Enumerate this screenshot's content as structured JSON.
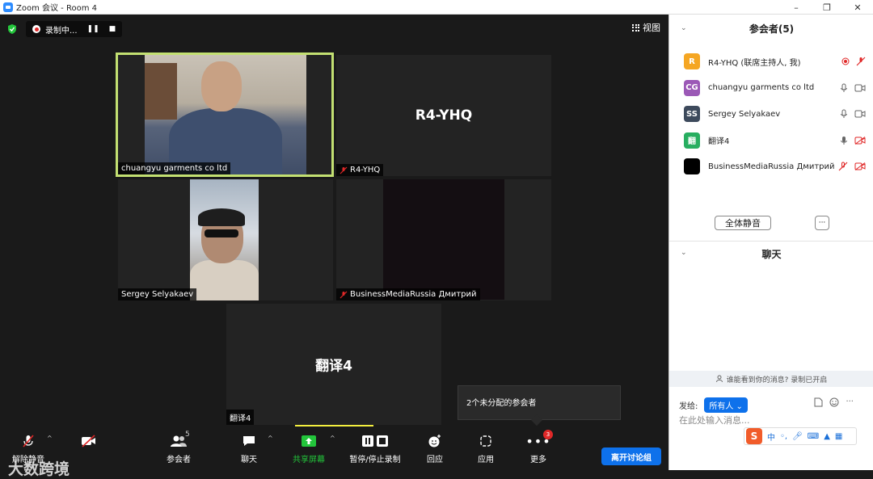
{
  "window": {
    "title": "Zoom 会议 - Room 4",
    "controls": [
      "–",
      "❐",
      "✕"
    ]
  },
  "topbar": {
    "recording_label": "录制中...",
    "view_label": "视图"
  },
  "tiles": [
    {
      "name": "chuangyu garments co ltd",
      "has_video": true,
      "active": true,
      "muted": false
    },
    {
      "name": "R4-YHQ",
      "big_label": "R4-YHQ",
      "has_video": false,
      "muted": true
    },
    {
      "name": "Sergey Selyakaev",
      "has_video": true,
      "muted": false
    },
    {
      "name": "BusinessMediaRussia Дмитрий",
      "has_video": true,
      "muted": true
    },
    {
      "name": "翻译4",
      "big_label": "翻译4",
      "has_video": false,
      "muted": false
    }
  ],
  "toolbar": {
    "mute_label": "解除静音",
    "participants_label": "参会者",
    "participants_count": "5",
    "chat_label": "聊天",
    "share_label": "共享屏幕",
    "record_label": "暂停/停止录制",
    "reactions_label": "回应",
    "apps_label": "应用",
    "more_label": "更多",
    "more_badge": "3",
    "close_breakout_label": "离开讨论组"
  },
  "unassigned_popup": "2个未分配的参会者",
  "watermark": "大数跨境",
  "panel": {
    "participants_title": "参会者(5)",
    "participants": [
      {
        "initials": "R",
        "color": "#f5a623",
        "name": "R4-YHQ (联席主持人, 我)",
        "recording": true,
        "mic": "muted",
        "video": "none"
      },
      {
        "initials": "CG",
        "color": "#9b59b6",
        "name": "chuangyu garments co ltd",
        "mic": "on",
        "video": "on"
      },
      {
        "initials": "SS",
        "color": "#3d4a5c",
        "name": "Sergey Selyakaev",
        "mic": "on",
        "video": "on"
      },
      {
        "initials": "翻",
        "color": "#27ae60",
        "name": "翻译4",
        "mic": "on",
        "video": "off"
      },
      {
        "initials": "",
        "color": "#000000",
        "name": "BusinessMediaRussia Дмитрий",
        "mic": "muted",
        "video": "off"
      }
    ],
    "mute_all_label": "全体静音",
    "more_label": "···",
    "chat_title": "聊天",
    "who_can_see": "谁能看到你的消息? 录制已开启",
    "send_to_label": "发给:",
    "send_to_value": "所有人",
    "input_placeholder": "在此处输入消息...",
    "ime_label": "中"
  },
  "colors": {
    "accent": "#0e71eb",
    "active_border": "#c3e072",
    "share_green": "#23c53b",
    "mute_red": "#e02828"
  }
}
